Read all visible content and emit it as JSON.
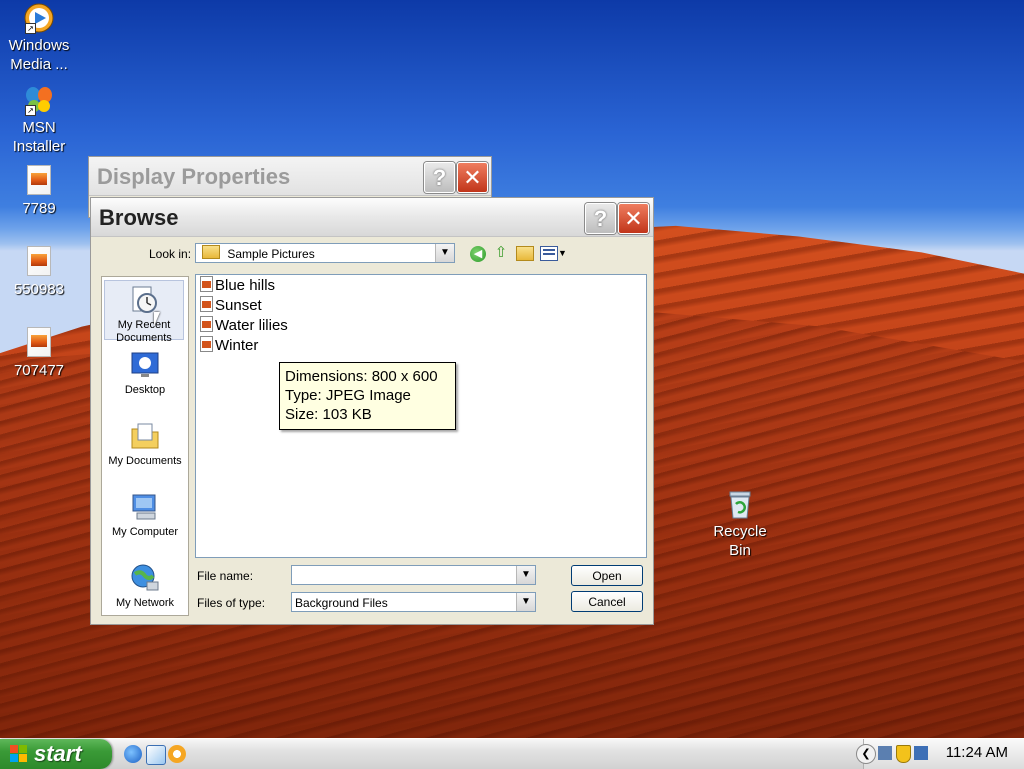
{
  "desktop": {
    "icons": [
      {
        "label": "Windows Media ...",
        "name": "windows-media-icon"
      },
      {
        "label": "MSN Installer",
        "name": "msn-installer-icon"
      },
      {
        "label": "7789"
      },
      {
        "label": "550983"
      },
      {
        "label": "707477"
      },
      {
        "label": "Recycle Bin"
      }
    ]
  },
  "display_properties": {
    "title": "Display Properties",
    "help_glyph": "?",
    "close_glyph": "✕"
  },
  "browse": {
    "title": "Browse",
    "help_glyph": "?",
    "close_glyph": "✕",
    "look_in_label": "Look in:",
    "look_in_value": "Sample Pictures",
    "places": [
      {
        "label": "My Recent Documents"
      },
      {
        "label": "Desktop"
      },
      {
        "label": "My Documents"
      },
      {
        "label": "My Computer"
      },
      {
        "label": "My Network"
      }
    ],
    "files": [
      "Blue hills",
      "Sunset",
      "Water lilies",
      "Winter"
    ],
    "tooltip": {
      "dimensions": "Dimensions: 800 x 600",
      "type": "Type: JPEG Image",
      "size": "Size: 103 KB"
    },
    "file_name_label": "File name:",
    "file_name_value": "",
    "file_type_label": "Files of type:",
    "file_type_value": "Background Files",
    "open_label": "Open",
    "cancel_label": "Cancel"
  },
  "taskbar": {
    "start_label": "start",
    "clock": "11:24 AM"
  }
}
